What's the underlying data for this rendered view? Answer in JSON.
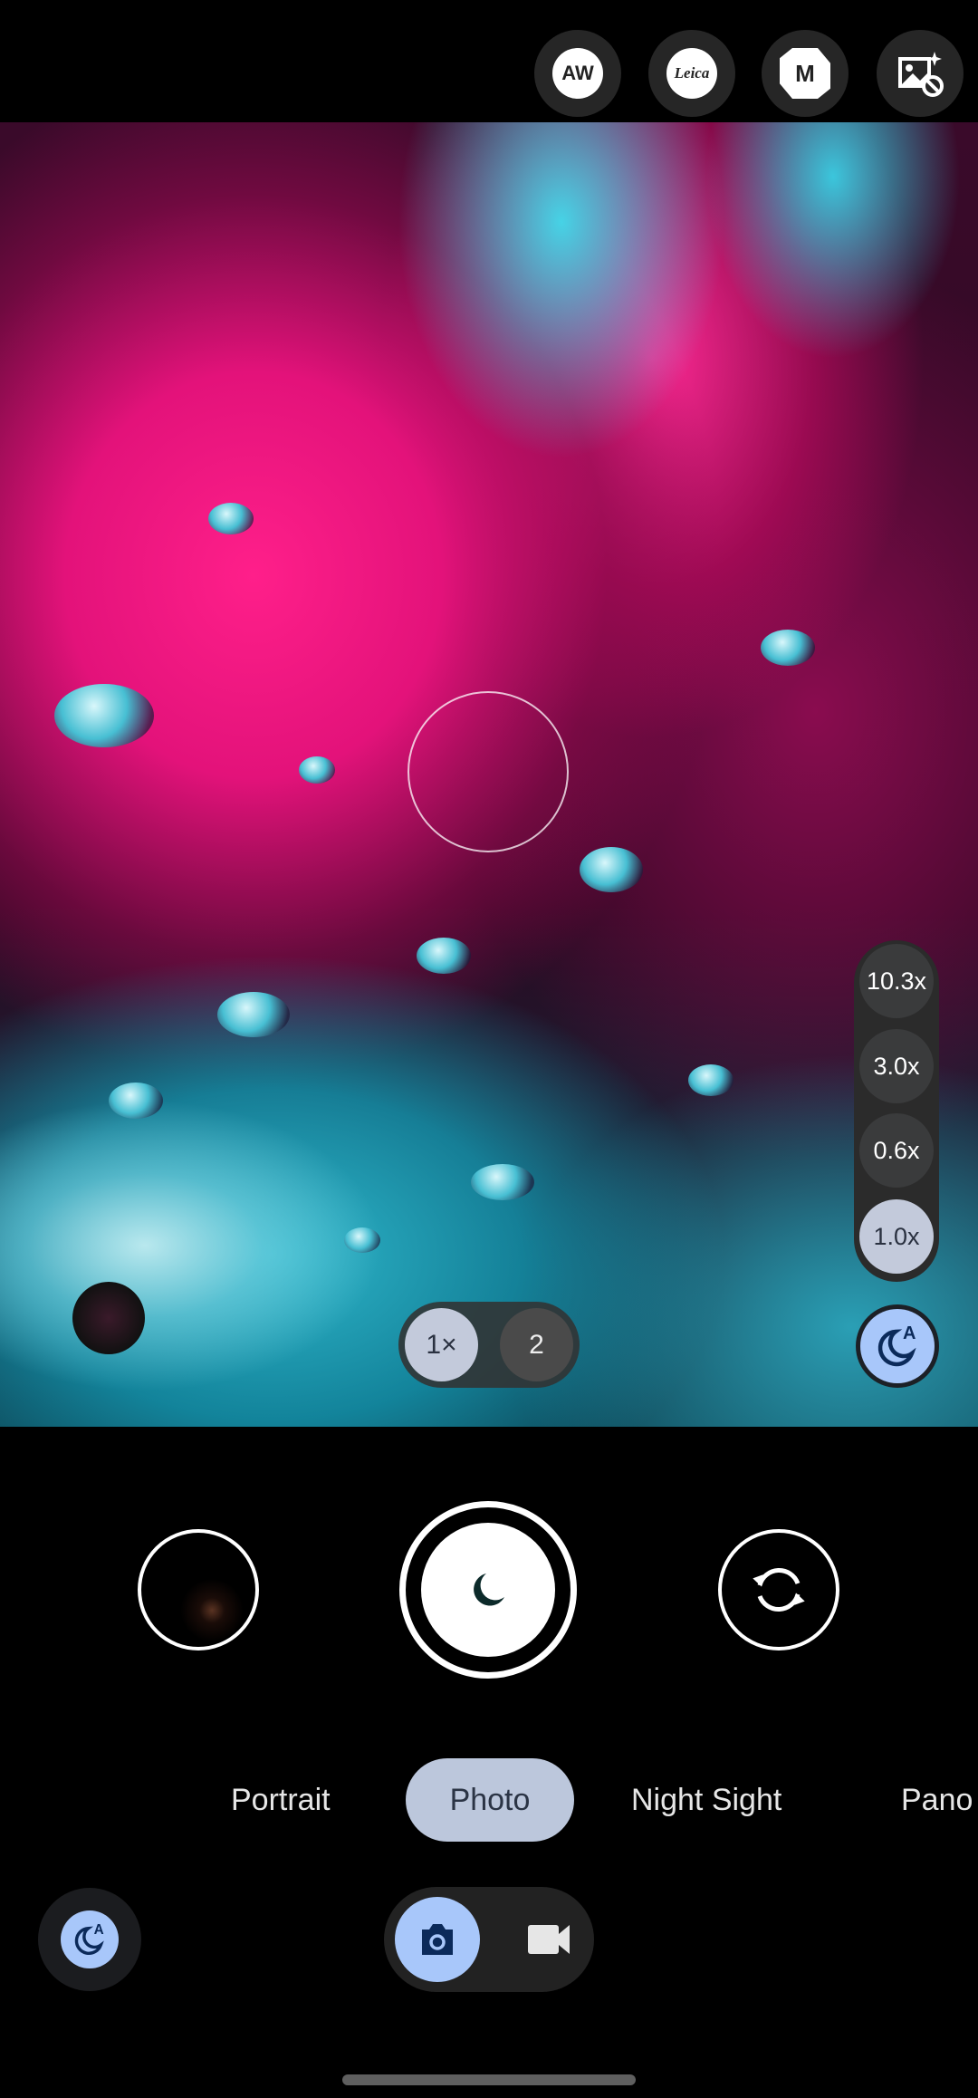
{
  "top_bar": {
    "buttons": [
      {
        "icon": "aw-icon",
        "label": "AW"
      },
      {
        "icon": "leica-icon",
        "label": "Leica"
      },
      {
        "icon": "m-mode-icon",
        "label": "M"
      },
      {
        "icon": "image-effects-off-icon"
      }
    ]
  },
  "viewfinder": {
    "zoom_levels": [
      {
        "label": "10.3x",
        "active": false
      },
      {
        "label": "3.0x",
        "active": false
      },
      {
        "label": "0.6x",
        "active": false
      },
      {
        "label": "1.0x",
        "active": true
      }
    ],
    "lens_toggle": [
      {
        "label": "1×",
        "active": true
      },
      {
        "label": "2",
        "active": false
      }
    ],
    "night_auto_label": "A"
  },
  "controls": {
    "shutter_icon": "moon-icon",
    "flip_icon": "flip-camera-icon"
  },
  "modes": {
    "items": [
      "Portrait",
      "Photo",
      "Night Sight",
      "Pano"
    ],
    "selected": "Photo"
  },
  "bottom": {
    "night_label": "A",
    "capture_toggle": [
      {
        "icon": "photo-camera-icon",
        "active": true
      },
      {
        "icon": "videocam-icon",
        "active": false
      }
    ]
  },
  "colors": {
    "accent": "#a8c7fa",
    "accent_dark": "#0b2a5a",
    "mode_selected_bg": "#bcc7dc",
    "button_bg": "#262626"
  }
}
